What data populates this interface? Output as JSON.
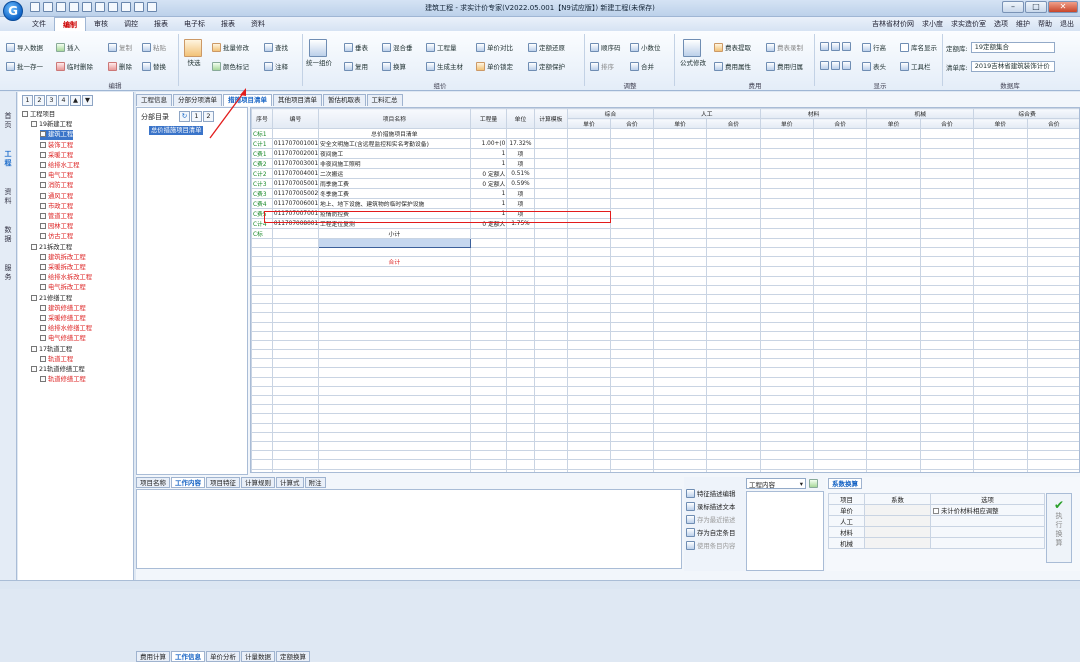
{
  "app": {
    "title": "建筑工程 - 求实计价专家(V2022.05.001【N9试应版】) 新建工程(未保存)"
  },
  "menu": {
    "items": [
      "文件",
      "编制",
      "审核",
      "调控",
      "报表",
      "电子标",
      "报表",
      "资料"
    ],
    "active": 1,
    "right": [
      "吉林省材价网",
      "求小度",
      "求实造价室",
      "选项",
      "维护",
      "帮助",
      "退出"
    ]
  },
  "ribbon": {
    "col1": [
      "导入数据",
      "批一存一",
      "插入",
      "临时删除",
      "复制",
      "删除",
      "粘贴",
      "替换"
    ],
    "kuaixuan": "快选",
    "col2": [
      "批量修改",
      "查找",
      "颜色标记",
      "注释"
    ],
    "tongyi": "统一组价",
    "col3": [
      "垂表",
      "混合垂",
      "工程量",
      "复用",
      "换算",
      "生成主材",
      "单价对比",
      "单价锁定",
      "定额还原",
      "定额保护"
    ],
    "col4": [
      "顺序码",
      "小数位",
      "排序",
      "合并"
    ],
    "gongshi": "公式修改",
    "col5": [
      "费表提取",
      "费表录制",
      "费用属性",
      "费用归属"
    ],
    "col6": [
      "行高",
      "库名显示",
      "表头",
      "工具栏"
    ],
    "dinge_label": "定额库:",
    "dinge_value": "19定额集合",
    "qingdan_label": "清单库:",
    "qingdan_value": "2019吉林省建筑装饰计价",
    "groups": [
      "编辑",
      "组价",
      "调整",
      "费用",
      "显示",
      "数据库"
    ]
  },
  "sidetabs": [
    "首页",
    "工程",
    "资料",
    "数据",
    "服务"
  ],
  "tree": {
    "nums": [
      "1",
      "2",
      "3",
      "4"
    ],
    "items": [
      {
        "label": "工程项目",
        "level": 0,
        "red": false
      },
      {
        "label": "19新建工程",
        "level": 1,
        "red": false
      },
      {
        "label": "建筑工程",
        "level": 2,
        "red": false,
        "selected": true
      },
      {
        "label": "装饰工程",
        "level": 2,
        "red": true
      },
      {
        "label": "采暖工程",
        "level": 2,
        "red": true
      },
      {
        "label": "给排水工程",
        "level": 2,
        "red": true
      },
      {
        "label": "电气工程",
        "level": 2,
        "red": true
      },
      {
        "label": "消防工程",
        "level": 2,
        "red": true
      },
      {
        "label": "通风工程",
        "level": 2,
        "red": true
      },
      {
        "label": "市政工程",
        "level": 2,
        "red": true
      },
      {
        "label": "管道工程",
        "level": 2,
        "red": true
      },
      {
        "label": "园林工程",
        "level": 2,
        "red": true
      },
      {
        "label": "仿古工程",
        "level": 2,
        "red": true
      },
      {
        "label": "21拆改工程",
        "level": 1,
        "red": false
      },
      {
        "label": "建筑拆改工程",
        "level": 2,
        "red": true
      },
      {
        "label": "采暖拆改工程",
        "level": 2,
        "red": true
      },
      {
        "label": "给排水拆改工程",
        "level": 2,
        "red": true
      },
      {
        "label": "电气拆改工程",
        "level": 2,
        "red": true
      },
      {
        "label": "21修缮工程",
        "level": 1,
        "red": false
      },
      {
        "label": "建筑修缮工程",
        "level": 2,
        "red": true
      },
      {
        "label": "采暖修缮工程",
        "level": 2,
        "red": true
      },
      {
        "label": "给排水修缮工程",
        "level": 2,
        "red": true
      },
      {
        "label": "电气修缮工程",
        "level": 2,
        "red": true
      },
      {
        "label": "17轨道工程",
        "level": 1,
        "red": false
      },
      {
        "label": "轨道工程",
        "level": 2,
        "red": true
      },
      {
        "label": "21轨道修缮工程",
        "level": 1,
        "red": false
      },
      {
        "label": "轨道修缮工程",
        "level": 2,
        "red": true
      }
    ]
  },
  "tabs": [
    "工程信息",
    "分部分项清单",
    "措施项目清单",
    "其他项目清单",
    "暂估机取表",
    "工料汇总"
  ],
  "active_tab": 2,
  "subdir": {
    "header": "分部目录",
    "nums": [
      "1",
      "2"
    ],
    "item": "总价措施项目清单"
  },
  "grid": {
    "headers": {
      "seq": "序号",
      "code": "编号",
      "name": "项目名称",
      "qty": "工程量",
      "unit": "单位",
      "method": "计算模板",
      "group1": "综合",
      "group2": "人工",
      "group3": "材料",
      "group4": "机械",
      "group5": "综合费",
      "sub_price": "单价",
      "sub_total": "合价"
    },
    "rows": [
      {
        "seq": "C标1",
        "code": "",
        "name": "总价措施项目清单",
        "qty": "",
        "unit": "",
        "center": true
      },
      {
        "seq": "C计1",
        "code": "011707001001",
        "name": "安全文明施工(含远程监控和实名考勤设备)",
        "qty": "1.00+(0",
        "unit": "17.32%",
        "center": false
      },
      {
        "seq": "C费1",
        "code": "011707002001",
        "name": "夜间施工",
        "qty": "1",
        "unit": "项",
        "center": false
      },
      {
        "seq": "C费2",
        "code": "011707003001",
        "name": "非夜间施工照明",
        "qty": "1",
        "unit": "项",
        "center": false
      },
      {
        "seq": "C计2",
        "code": "011707004001",
        "name": "二次搬运",
        "qty": "0 定额人",
        "unit": "0.51%",
        "center": false
      },
      {
        "seq": "C计3",
        "code": "011707005001",
        "name": "雨季施工费",
        "qty": "0 定额人",
        "unit": "0.59%",
        "center": false
      },
      {
        "seq": "C费3",
        "code": "011707005002",
        "name": "冬季施工费",
        "qty": "1",
        "unit": "项",
        "center": false
      },
      {
        "seq": "C费4",
        "code": "011707006001",
        "name": "地上、地下设施、建筑物的临时保护设施",
        "qty": "1",
        "unit": "项",
        "center": false
      },
      {
        "seq": "C费5",
        "code": "011707007001",
        "name": "疫情防控费",
        "qty": "1",
        "unit": "项",
        "center": false
      },
      {
        "seq": "C计4",
        "code": "011707008001",
        "name": "工程定位复测",
        "qty": "0 定额人",
        "unit": "1.75%",
        "center": false
      },
      {
        "seq": "C标",
        "code": "",
        "name": "小计",
        "qty": "",
        "unit": "",
        "center": true
      }
    ],
    "total_label": "合计"
  },
  "bottom": {
    "tabs": [
      "项目名称",
      "工作内容",
      "项目特征",
      "计算规则",
      "计算式",
      "附注"
    ],
    "active_tab": 1,
    "tabs2": [
      "费用计算",
      "工作信息",
      "单价分析",
      "计量数据",
      "定额换算"
    ],
    "active_tab2": 1,
    "actions": [
      {
        "label": "特征描述编辑",
        "disabled": false
      },
      {
        "label": "录标描述文本",
        "disabled": false
      },
      {
        "label": "存为最近描述",
        "disabled": true
      },
      {
        "label": "存为自定条目",
        "disabled": false
      },
      {
        "label": "使用条目内容",
        "disabled": true
      }
    ],
    "content_dropdown": "工程内容",
    "calc_tab": "系数换算",
    "calc_headers": [
      "项目",
      "系数",
      "选项"
    ],
    "calc_rows": [
      "单价",
      "人工",
      "材料",
      "机械"
    ],
    "calc_option": "未计价材料相应调整",
    "exec_label": "执行换算"
  },
  "colors": {
    "accent": "#1462c4",
    "highlight": "#e21c1c",
    "red_text": "#d22222"
  }
}
